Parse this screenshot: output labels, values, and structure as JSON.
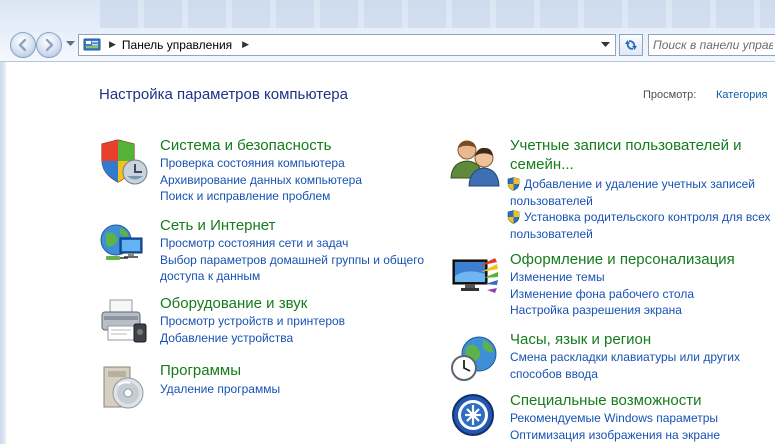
{
  "address": {
    "crumb": "Панель управления",
    "search_placeholder": "Поиск в панели управления"
  },
  "header": {
    "title": "Настройка параметров компьютера",
    "view_label": "Просмотр:",
    "view_value": "Категория"
  },
  "categories": {
    "system": {
      "title": "Система и безопасность",
      "links": [
        "Проверка состояния компьютера",
        "Архивирование данных компьютера",
        "Поиск и исправление проблем"
      ]
    },
    "network": {
      "title": "Сеть и Интернет",
      "links": [
        "Просмотр состояния сети и задач",
        "Выбор параметров домашней группы и общего",
        "доступа к данным"
      ]
    },
    "hardware": {
      "title": "Оборудование и звук",
      "links": [
        "Просмотр устройств и принтеров",
        "Добавление устройства"
      ]
    },
    "programs": {
      "title": "Программы",
      "links": [
        "Удаление программы"
      ]
    },
    "users": {
      "title_line1": "Учетные записи пользователей и",
      "title_line2": "семейн...",
      "links": [
        "Добавление и удаление учетных записей",
        "пользователей",
        "Установка родительского контроля для всех",
        "пользователей"
      ]
    },
    "appearance": {
      "title": "Оформление и персонализация",
      "links": [
        "Изменение темы",
        "Изменение фона рабочего стола",
        "Настройка разрешения экрана"
      ]
    },
    "clock": {
      "title": "Часы, язык и регион",
      "links": [
        "Смена раскладки клавиатуры или других",
        "способов ввода"
      ]
    },
    "access": {
      "title": "Специальные возможности",
      "links": [
        "Рекомендуемые Windows параметры",
        "Оптимизация изображения на экране"
      ]
    }
  },
  "colors": {
    "category_title": "#157c1c",
    "link": "#1852b4",
    "heading": "#1e3287"
  },
  "icons": {
    "back": "back-arrow-icon",
    "forward": "forward-arrow-icon",
    "refresh": "refresh-icon",
    "uac": "uac-shield-icon"
  }
}
